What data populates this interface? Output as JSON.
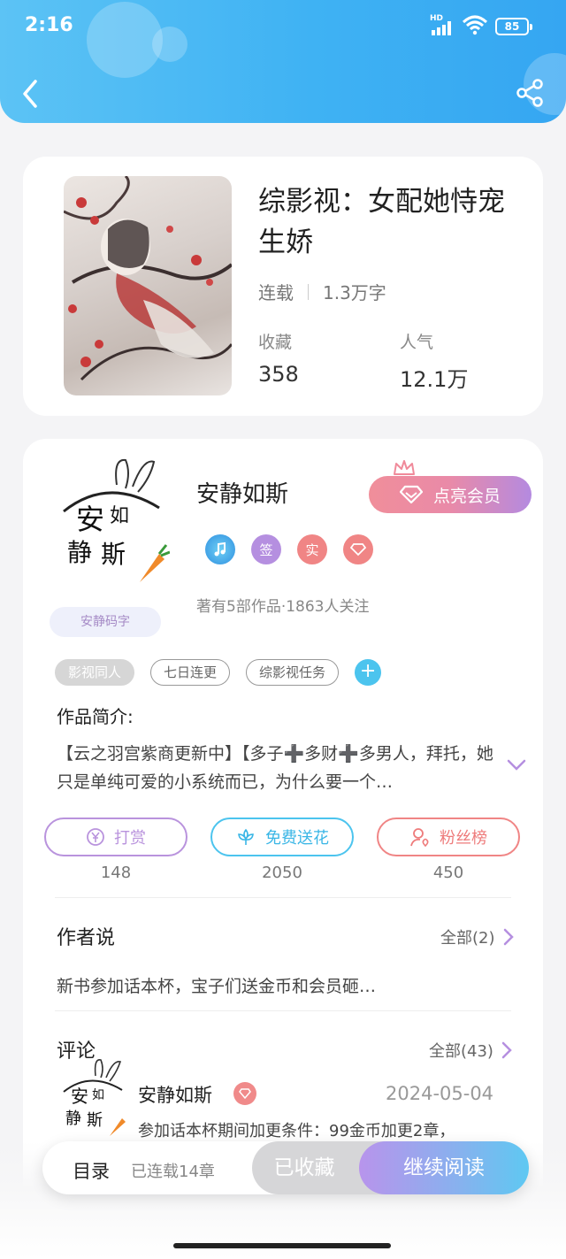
{
  "status_bar": {
    "time": "2:16",
    "network": "HD",
    "battery": "85"
  },
  "book": {
    "title": "综影视：女配她恃宠生娇",
    "status": "连载",
    "word_count": "1.3万字",
    "favorites_label": "收藏",
    "favorites_value": "358",
    "popularity_label": "人气",
    "popularity_value": "12.1万"
  },
  "author": {
    "name": "安静如斯",
    "badge_text": "安静码字",
    "vip_button": "点亮会员",
    "badges": [
      "签",
      "实"
    ],
    "info": "著有5部作品·1863人关注"
  },
  "tags": [
    "影视同人",
    "七日连更",
    "综影视任务"
  ],
  "intro": {
    "label": "作品简介:",
    "text": "【云之羽宫紫商更新中】【多子➕多财➕多男人，拜托，她只是单纯可爱的小系统而已，为什么要一个…"
  },
  "actions": [
    {
      "label": "打赏",
      "count": "148",
      "icon": "yen-icon",
      "color": "#b993dd"
    },
    {
      "label": "免费送花",
      "count": "2050",
      "icon": "flower-icon",
      "color": "#4cc4ee"
    },
    {
      "label": "粉丝榜",
      "count": "450",
      "icon": "fan-icon",
      "color": "#f08585"
    }
  ],
  "author_says": {
    "title": "作者说",
    "more": "全部(2)",
    "text": "新书参加话本杯，宝子们送金币和会员砸…"
  },
  "comments": {
    "title": "评论",
    "more": "全部(43)",
    "items": [
      {
        "user": "安静如斯",
        "date": "2024-05-04",
        "text": "参加话本杯期间加更条件：99金币加更2章，"
      }
    ]
  },
  "bottom_bar": {
    "toc": "目录",
    "toc_sub": "已连载14章",
    "favorited": "已收藏",
    "continue": "继续阅读"
  }
}
